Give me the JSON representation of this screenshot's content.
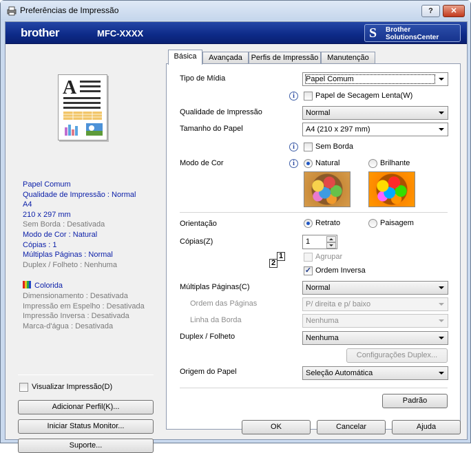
{
  "window": {
    "title": "Preferências de Impressão",
    "help_label": "?",
    "close_label": "✕"
  },
  "banner": {
    "brand": "brother",
    "model": "MFC-XXXX",
    "solutions_line1": "Brother",
    "solutions_line2": "SolutionsCenter"
  },
  "summary": {
    "lines": [
      {
        "text": "Papel Comum",
        "active": true
      },
      {
        "text": "Qualidade de Impressão : Normal",
        "active": true
      },
      {
        "text": "A4",
        "active": true
      },
      {
        "text": "210 x 297 mm",
        "active": true
      },
      {
        "text": "Sem Borda : Desativada",
        "active": false
      },
      {
        "text": "Modo de Cor : Natural",
        "active": true
      },
      {
        "text": "Cópias : 1",
        "active": true
      },
      {
        "text": "Múltiplas Páginas : Normal",
        "active": true
      },
      {
        "text": "Duplex / Folheto : Nenhuma",
        "active": false
      }
    ],
    "color_label": "Colorida",
    "extra_lines": [
      "Dimensionamento : Desativada",
      "Impressão em Espelho : Desativada",
      "Impressão Inversa : Desativada",
      "Marca-d'água : Desativada"
    ]
  },
  "left_controls": {
    "preview_checkbox": "Visualizar Impressão(D)",
    "preview_checked": false,
    "add_profile": "Adicionar Perfil(K)...",
    "status_monitor": "Iniciar Status Monitor...",
    "support": "Suporte..."
  },
  "tabs": [
    {
      "label": "Básica",
      "active": true
    },
    {
      "label": "Avançada",
      "active": false
    },
    {
      "label": "Perfis de Impressão",
      "active": false
    },
    {
      "label": "Manutenção",
      "active": false
    }
  ],
  "basic": {
    "media_type": {
      "label": "Tipo de Mídia",
      "value": "Papel Comum"
    },
    "slow_dry": {
      "label": "Papel de Secagem Lenta(W)",
      "checked": false
    },
    "quality": {
      "label": "Qualidade de Impressão",
      "value": "Normal"
    },
    "paper_size": {
      "label": "Tamanho do Papel",
      "value": "A4 (210 x 297 mm)"
    },
    "borderless": {
      "label": "Sem Borda",
      "checked": false
    },
    "color_mode": {
      "label": "Modo de Cor",
      "option_natural": "Natural",
      "option_vivid": "Brilhante",
      "selected": "Natural"
    },
    "orientation": {
      "label": "Orientação",
      "option_portrait": "Retrato",
      "option_landscape": "Paisagem",
      "selected": "Retrato"
    },
    "copies": {
      "label": "Cópias(Z)",
      "value": "1"
    },
    "collate": {
      "label": "Agrupar",
      "checked": false,
      "enabled": false
    },
    "reverse_order": {
      "label": "Ordem Inversa",
      "checked": true
    },
    "order_icon_digits": [
      "2",
      "1"
    ],
    "multiple_pages": {
      "label": "Múltiplas Páginas(C)",
      "value": "Normal"
    },
    "page_order": {
      "label": "Ordem das Páginas",
      "value": "P/ direita e p/ baixo"
    },
    "border_line": {
      "label": "Linha da Borda",
      "value": "Nenhuma"
    },
    "duplex": {
      "label": "Duplex / Folheto",
      "value": "Nenhuma"
    },
    "duplex_settings": "Configurações Duplex...",
    "paper_source": {
      "label": "Origem do Papel",
      "value": "Seleção Automática"
    },
    "default_button": "Padrão"
  },
  "dialog_buttons": {
    "ok": "OK",
    "cancel": "Cancelar",
    "help": "Ajuda"
  },
  "colors": {
    "banner": "#0d2a87",
    "summary_active": "#0a1ea8",
    "summary_inactive": "#7a7a7a"
  }
}
